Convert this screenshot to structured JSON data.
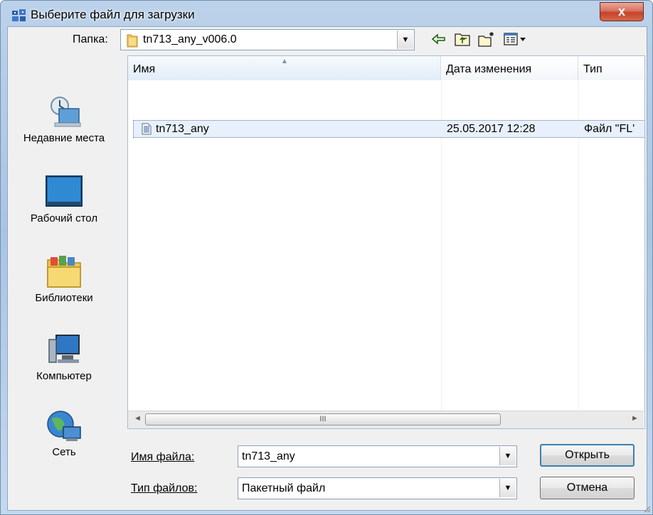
{
  "window": {
    "title": "Выберите файл для загрузки",
    "close_glyph": "x"
  },
  "toolbar": {
    "look_in_label": "Папка:",
    "look_in_value": "tn713_any_v006.0",
    "icons": [
      "back-arrow-icon",
      "up-one-level-icon",
      "new-folder-icon",
      "view-menu-icon"
    ]
  },
  "places": [
    {
      "label": "Недавние места",
      "icon": "recent-places-icon"
    },
    {
      "label": "Рабочий стол",
      "icon": "desktop-icon"
    },
    {
      "label": "Библиотеки",
      "icon": "libraries-icon"
    },
    {
      "label": "Компьютер",
      "icon": "computer-icon"
    },
    {
      "label": "Сеть",
      "icon": "network-icon"
    }
  ],
  "file_list": {
    "columns": [
      "Имя",
      "Дата изменения",
      "Тип"
    ],
    "rows": [
      {
        "name": "tn713_any",
        "modified": "25.05.2017 12:28",
        "type": "Файл \"FL'"
      }
    ]
  },
  "scrollbar": {
    "thumb_glyph": "III",
    "left_glyph": "◄",
    "right_glyph": "►"
  },
  "form": {
    "file_name_label": "Имя файла:",
    "file_name_value": "tn713_any",
    "file_type_label": "Тип файлов:",
    "file_type_value": "Пакетный файл",
    "open_button": "Открыть",
    "cancel_button": "Отмена"
  },
  "colors": {
    "accent": "#3c7fb1",
    "selection": "#e8f1fb",
    "title_bar": "#bcd2ea",
    "close_red": "#c4432b"
  }
}
